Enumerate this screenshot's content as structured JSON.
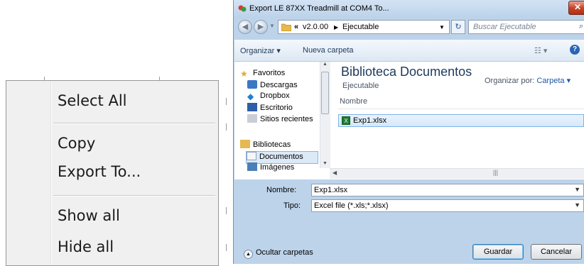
{
  "context_menu": {
    "items": [
      {
        "label": "Select All"
      },
      {
        "label": "Copy"
      },
      {
        "label": "Export To..."
      },
      {
        "label": "Show all"
      },
      {
        "label": "Hide all"
      }
    ]
  },
  "dialog": {
    "title": "Export LE 87XX Treadmill at COM4 To...",
    "close_label": "✕",
    "address": {
      "chevrons": "«",
      "segments": [
        "v2.0.00",
        "Ejecutable"
      ]
    },
    "search_placeholder": "Buscar Ejecutable",
    "toolbar": {
      "organize": "Organizar ▾",
      "new_folder": "Nueva carpeta"
    },
    "nav_pane": {
      "items": [
        {
          "label": "Favoritos",
          "icon": "star-icon"
        },
        {
          "label": "Descargas",
          "icon": "downloads-icon"
        },
        {
          "label": "Dropbox",
          "icon": "dropbox-icon"
        },
        {
          "label": "Escritorio",
          "icon": "desktop-icon"
        },
        {
          "label": "Sitios recientes",
          "icon": "recent-places-icon"
        },
        {
          "label": "Bibliotecas",
          "icon": "libraries-icon"
        },
        {
          "label": "Documentos",
          "icon": "documents-icon"
        },
        {
          "label": "Imágenes",
          "icon": "pictures-icon"
        }
      ]
    },
    "library": {
      "title": "Biblioteca Documentos",
      "subtitle": "Ejecutable",
      "organize_by_label": "Organizar por:",
      "organize_by_value": "Carpeta ▾",
      "column_name": "Nombre",
      "files": [
        "Exp1.xlsx"
      ]
    },
    "form": {
      "name_label": "Nombre:",
      "name_value": "Exp1.xlsx",
      "type_label": "Tipo:",
      "type_value": "Excel file (*.xls;*.xlsx)"
    },
    "footer": {
      "hide_folders": "Ocultar carpetas",
      "save": "Guardar",
      "cancel": "Cancelar"
    },
    "colors": {
      "frame": "#bcd3ea",
      "accent": "#1e395b",
      "selection": "#d6e8fb"
    }
  }
}
